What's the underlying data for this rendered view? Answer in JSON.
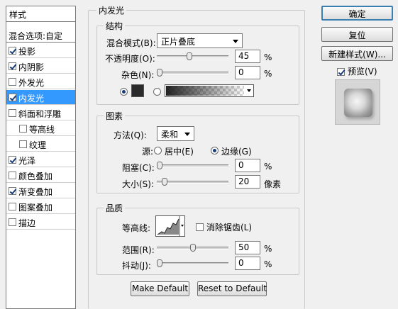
{
  "style_list": {
    "header": "样式",
    "blending_options": "混合选项:自定",
    "items": [
      {
        "label": "投影",
        "checked": true
      },
      {
        "label": "内阴影",
        "checked": true
      },
      {
        "label": "外发光",
        "checked": false
      },
      {
        "label": "内发光",
        "checked": true,
        "selected": true
      },
      {
        "label": "斜面和浮雕",
        "checked": false
      },
      {
        "label": "等高线",
        "checked": false,
        "sub": true
      },
      {
        "label": "纹理",
        "checked": false,
        "sub": true
      },
      {
        "label": "光泽",
        "checked": true
      },
      {
        "label": "颜色叠加",
        "checked": false
      },
      {
        "label": "渐变叠加",
        "checked": true
      },
      {
        "label": "图案叠加",
        "checked": false
      },
      {
        "label": "描边",
        "checked": false
      }
    ]
  },
  "panel": {
    "title": "内发光",
    "structure": {
      "title": "结构",
      "blend_mode_label": "混合模式(B):",
      "blend_mode_value": "正片叠底",
      "opacity_label": "不透明度(O):",
      "opacity_value": "45",
      "opacity_unit": "%",
      "opacity_level": 0.45,
      "noise_label": "杂色(N):",
      "noise_value": "0",
      "noise_unit": "%",
      "noise_level": 0,
      "color_mode": "color",
      "swatch_color": "#2b2b2b"
    },
    "elements": {
      "title": "图素",
      "method_label": "方法(Q):",
      "method_value": "柔和",
      "source_label": "源:",
      "source_center": "居中(E)",
      "source_edge": "边缘(G)",
      "source_selected": "edge",
      "choke_label": "阻塞(C):",
      "choke_value": "0",
      "choke_unit": "%",
      "choke_level": 0,
      "size_label": "大小(S):",
      "size_value": "20",
      "size_unit": "像素",
      "size_level": 0.08
    },
    "quality": {
      "title": "品质",
      "contour_label": "等高线:",
      "anti_alias_label": "消除锯齿(L)",
      "anti_alias_checked": false,
      "range_label": "范围(R):",
      "range_value": "50",
      "range_unit": "%",
      "range_level": 0.5,
      "jitter_label": "抖动(J):",
      "jitter_value": "0",
      "jitter_unit": "%",
      "jitter_level": 0
    },
    "make_default": "Make Default",
    "reset_default": "Reset to Default"
  },
  "buttons": {
    "ok": "确定",
    "reset": "复位",
    "new_style": "新建样式(W)...",
    "preview_label": "预览(V)",
    "preview_checked": true
  }
}
